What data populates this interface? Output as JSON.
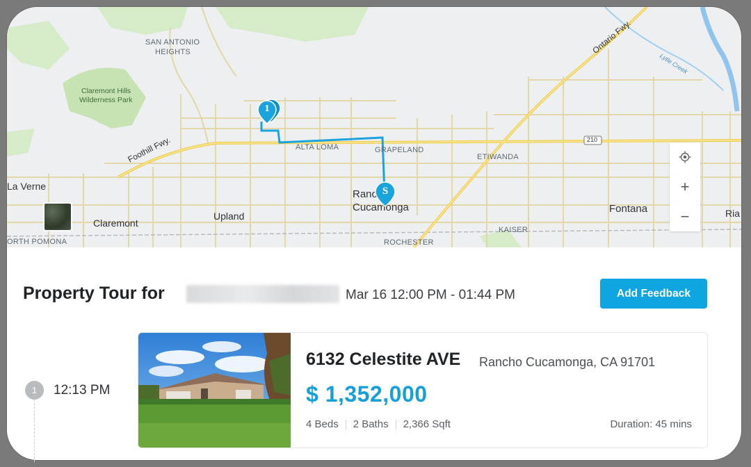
{
  "map": {
    "labels": {
      "san_antonio_heights_1": "SAN ANTONIO",
      "san_antonio_heights_2": "HEIGHTS",
      "park_1": "Claremont Hills",
      "park_2": "Wilderness Park",
      "foothill": "Foothill Fwy.",
      "ontario": "Ontario Fwy.",
      "lytle": "Lytle Creek",
      "alta_loma": "ALTA LOMA",
      "grapeland": "GRAPELAND",
      "etiwanda": "ETIWANDA",
      "la_verne": "La Verne",
      "rancho_1": "Rancho",
      "rancho_2": "Cucamonga",
      "claremont": "Claremont",
      "upland": "Upland",
      "fontana": "Fontana",
      "kaiser": "KAISER",
      "rochester": "ROCHESTER",
      "north_pomona": "ORTH POMONA",
      "rialto": "Ria",
      "route_210": "210"
    },
    "markers": {
      "stop_1": "1",
      "start": "S"
    },
    "controls": {
      "locate_icon": "locate-icon",
      "zoom_in": "+",
      "zoom_out": "−"
    }
  },
  "tour": {
    "title": "Property Tour for",
    "time_range": "Mar 16 12:00 PM - 01:44 PM",
    "feedback_button": "Add Feedback"
  },
  "stops": [
    {
      "number": "1",
      "time": "12:13 PM",
      "address": "6132 Celestite AVE",
      "city": "Rancho Cucamonga, CA 91701",
      "price": "$ 1,352,000",
      "beds": "4 Beds",
      "baths": "2 Baths",
      "sqft": "2,366 Sqft",
      "duration": "Duration: 45 mins"
    }
  ],
  "colors": {
    "accent": "#0ea5e0",
    "price": "#169fd8",
    "route": "#1aa3dc",
    "freeway": "#f4d35e",
    "park": "#c7e3b4"
  }
}
